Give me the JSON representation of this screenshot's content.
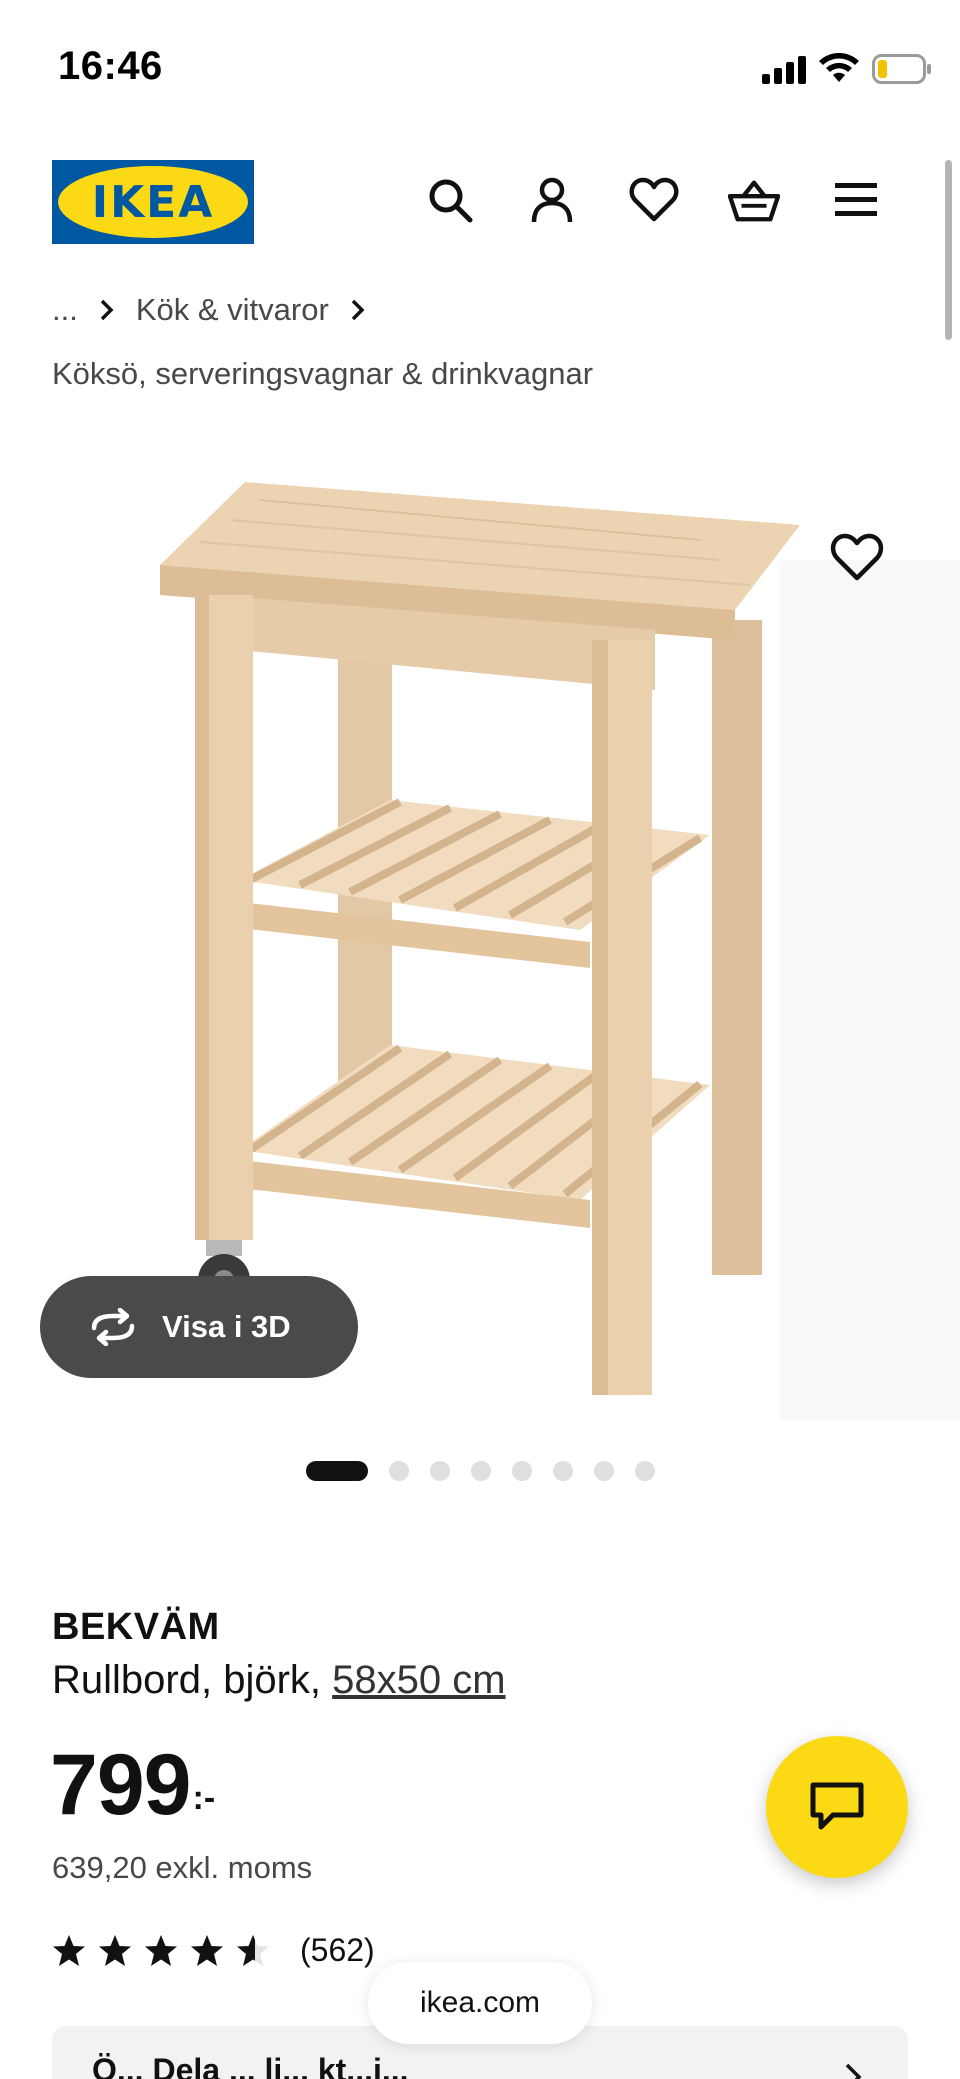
{
  "status_bar": {
    "time": "16:46"
  },
  "header": {
    "logo_text": "IKEA",
    "brand_colors": {
      "blue": "#0058a3",
      "yellow": "#fbd914"
    },
    "icons": [
      "search-icon",
      "account-icon",
      "wishlist-icon",
      "cart-icon",
      "menu-icon"
    ]
  },
  "breadcrumb": {
    "ellipsis": "...",
    "level1": "Kök & vitvaror",
    "level2": "Köksö, serveringsvagnar & drinkvagnar"
  },
  "gallery": {
    "view_3d_label": "Visa i 3D",
    "image_count": 8,
    "active_index": 0
  },
  "product": {
    "name": "BEKVÄM",
    "description": "Rullbord, björk, ",
    "size": "58x50 cm",
    "price": "799",
    "price_suffix": ":-",
    "price_excl_vat": "639,20 exkl. moms",
    "rating": 4.5,
    "rating_count": "(562)"
  },
  "browser": {
    "url": "ikea.com"
  },
  "bottom_card": {
    "text": "Ö... Dela ... li... kt...i..."
  }
}
